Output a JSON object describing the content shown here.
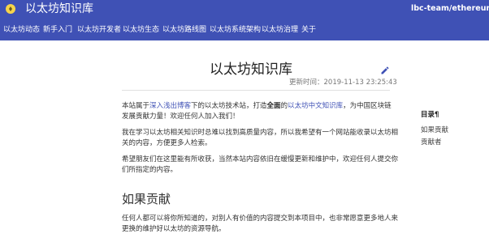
{
  "header": {
    "site_title": "以太坊知识库",
    "repo_link": "lbc-team/ethereum_c",
    "nav": [
      {
        "label": "以太坊动态"
      },
      {
        "label": "新手入门"
      },
      {
        "label": "以太坊开发者"
      },
      {
        "label": "以太坊生态"
      },
      {
        "label": "以太坊路线图"
      },
      {
        "label": "以太坊系统架构"
      },
      {
        "label": "以太坊治理"
      },
      {
        "label": "关于"
      }
    ]
  },
  "article": {
    "title": "以太坊知识库",
    "updated": "更新时间：2019-11-13 23:25:43",
    "p1": {
      "t1": "本站属于",
      "link1": "深入浅出博客",
      "t2": "下的以太坊技术站，打造",
      "bold": "全面",
      "t3": "的",
      "link2": "以太坊中文知识库",
      "t4": "，为中国区块链发展贡献力量！欢迎任何人加入我们！"
    },
    "p2": "我在学习以太坊相关知识时总难以找到高质量内容，所以我希望有一个网站能收录以太坊相关的内容，方便更多人检索。",
    "p3": "希望朋友们在这里能有所收获，当然本站内容依旧在缓慢更新和维护中，欢迎任何人提交你们所指定的内容。",
    "h2": "如果贡献",
    "p4": "任何人都可以将你所知道的，对别人有价值的内容提交到本项目中，也非常愿意更多地人来更换的维护好以太坊的资源导航。"
  },
  "toc": {
    "title": "目录¶",
    "items": [
      {
        "label": "如果贡献"
      },
      {
        "label": "贡献者"
      }
    ]
  },
  "colors": {
    "header": "#3f51b5",
    "link": "#3f51b5",
    "logo": "#f6d44c"
  },
  "icons": [
    "ethereum-logo-icon",
    "edit-pencil-icon"
  ]
}
